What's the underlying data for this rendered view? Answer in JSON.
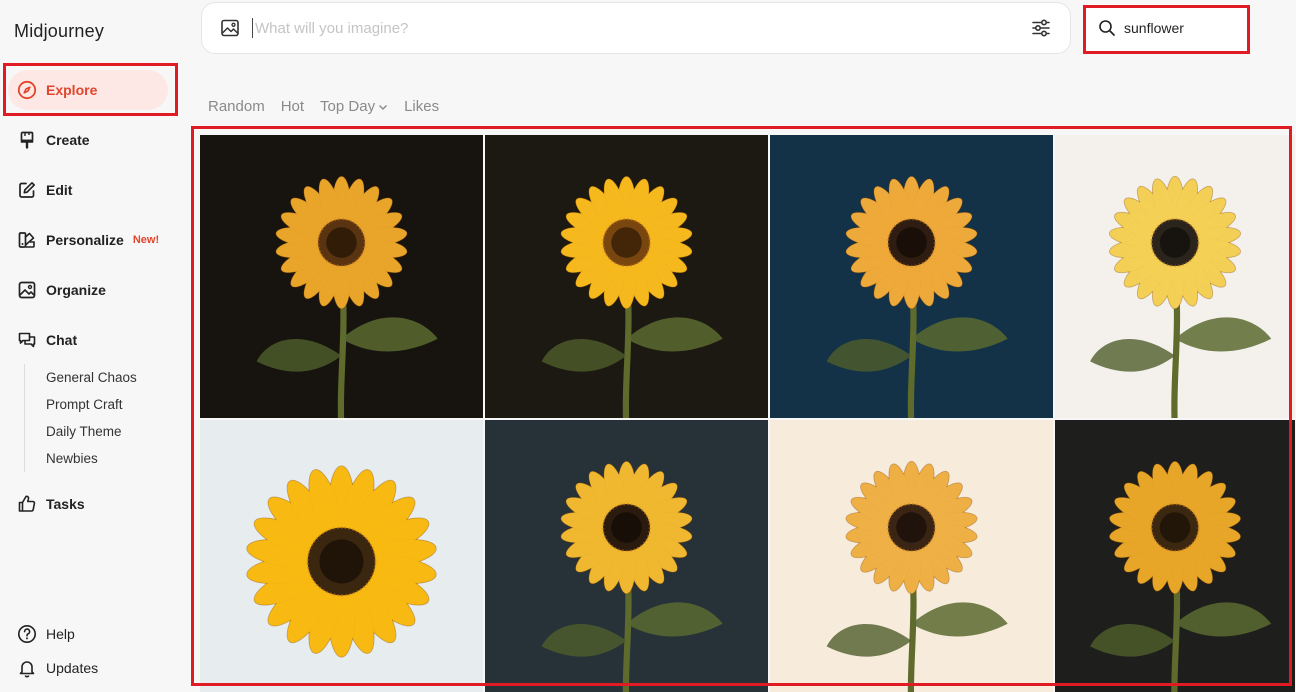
{
  "brand": "Midjourney",
  "nav": {
    "explore": "Explore",
    "create": "Create",
    "edit": "Edit",
    "personalize": "Personalize",
    "personalize_badge": "New!",
    "organize": "Organize",
    "chat": "Chat",
    "chat_channels": [
      "General Chaos",
      "Prompt Craft",
      "Daily Theme",
      "Newbies"
    ],
    "tasks": "Tasks",
    "help": "Help",
    "updates": "Updates"
  },
  "prompt": {
    "placeholder": "What will you imagine?",
    "value": ""
  },
  "search": {
    "value": "sunflower"
  },
  "tabs": {
    "random": "Random",
    "hot": "Hot",
    "top_day": "Top Day",
    "likes": "Likes"
  },
  "colors": {
    "accent": "#e2452c",
    "highlight_frame": "#e01b24"
  },
  "gallery": [
    {
      "subject": "sunflower",
      "bg": "#17140f",
      "petal": "#e9a52a",
      "center": "#5a3410"
    },
    {
      "subject": "sunflower",
      "bg": "#1c1812",
      "petal": "#f5b91e",
      "center": "#7a4610"
    },
    {
      "subject": "sunflower",
      "bg": "#133247",
      "petal": "#eda93a",
      "center": "#2e1d10"
    },
    {
      "subject": "sunflower",
      "bg": "#f4f1ec",
      "petal": "#f4cf55",
      "center": "#2a241c"
    },
    {
      "subject": "sunflower",
      "bg": "#e7ecee",
      "petal": "#f7b912",
      "center": "#3b2610"
    },
    {
      "subject": "sunflower",
      "bg": "#263238",
      "petal": "#f0b830",
      "center": "#2a1b0e"
    },
    {
      "subject": "sunflower",
      "bg": "#f7ecdc",
      "petal": "#eeb045",
      "center": "#3a2414"
    },
    {
      "subject": "sunflower",
      "bg": "#1e1e1c",
      "petal": "#e8a628",
      "center": "#3c2810"
    }
  ]
}
